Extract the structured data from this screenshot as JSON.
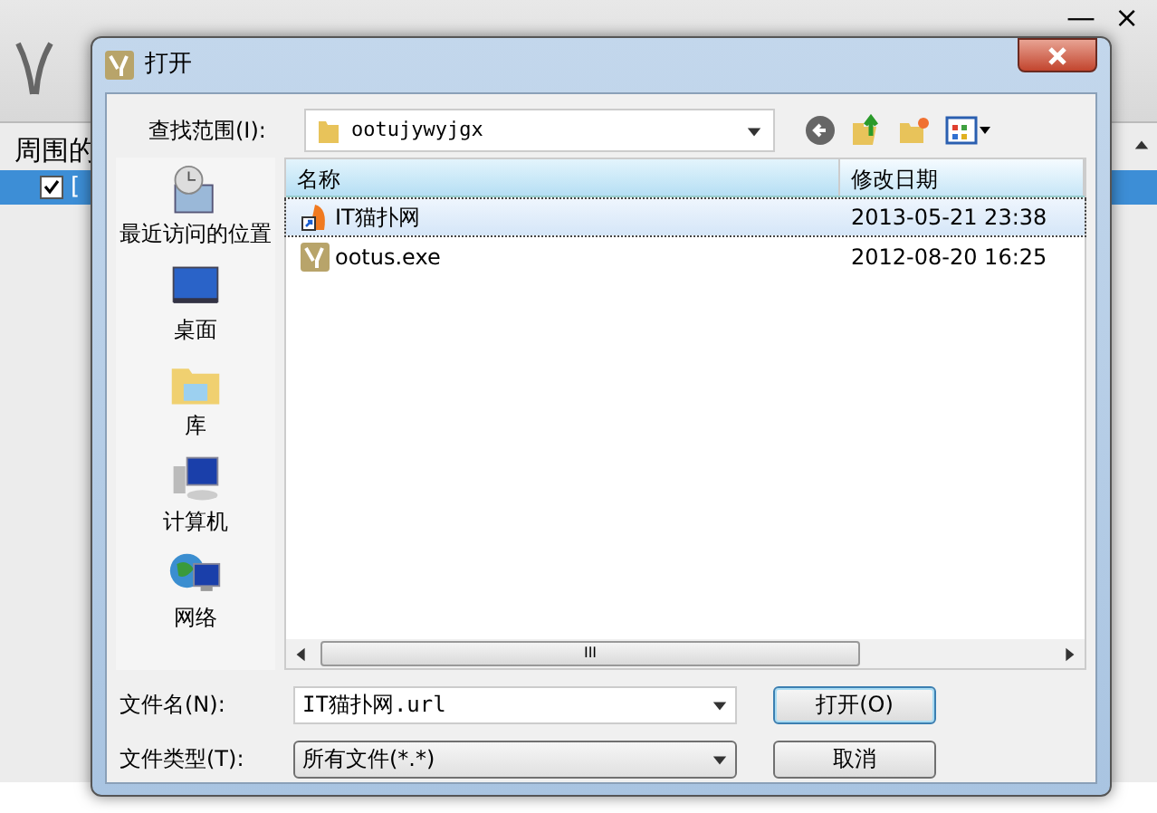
{
  "app": {
    "window_controls": [
      "—",
      "×"
    ],
    "heading": "周围的",
    "rows": [
      {
        "label": "[",
        "checked": true,
        "selected": true
      }
    ]
  },
  "dialog": {
    "title": "打开",
    "look_in": {
      "label": "查找范围(I):",
      "value": "ootujywyjgx"
    },
    "places": [
      {
        "label": "最近访问的位置",
        "kind": "recent"
      },
      {
        "label": "桌面",
        "kind": "desktop"
      },
      {
        "label": "库",
        "kind": "library"
      },
      {
        "label": "计算机",
        "kind": "computer"
      },
      {
        "label": "网络",
        "kind": "network"
      }
    ],
    "columns": [
      "名称",
      "修改日期"
    ],
    "files": [
      {
        "name": "IT猫扑网",
        "modified": "2013-05-21 23:38",
        "kind": "shortcut",
        "selected": true
      },
      {
        "name": "ootus.exe",
        "modified": "2012-08-20 16:25",
        "kind": "exe",
        "selected": false
      }
    ],
    "scrollbar_grip": "III",
    "file_name": {
      "label": "文件名(N):",
      "value": "IT猫扑网.url"
    },
    "file_type": {
      "label": "文件类型(T):",
      "value": "所有文件(*.*)"
    },
    "buttons": [
      "打开(O)",
      "取消"
    ]
  }
}
